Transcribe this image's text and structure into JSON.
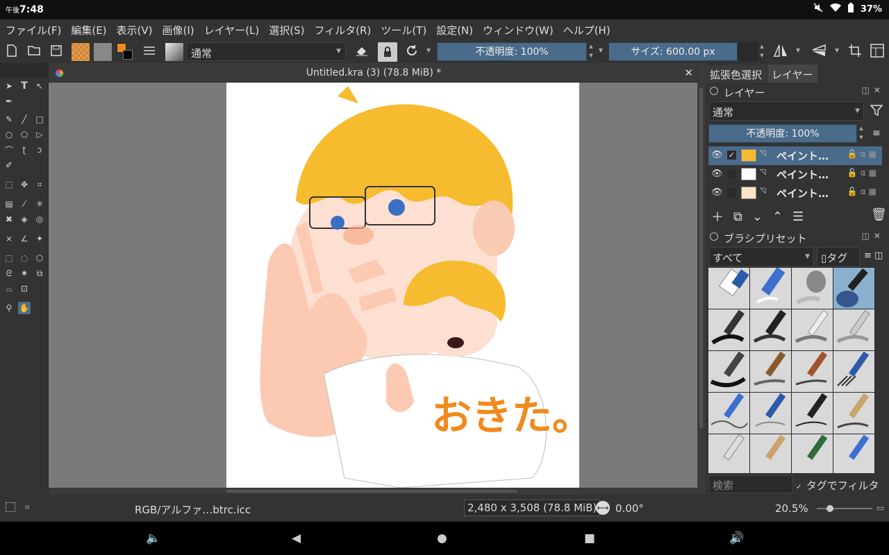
{
  "status_bar": {
    "time_prefix": "午後",
    "time": "7:48",
    "battery": "37%"
  },
  "menu": [
    "ファイル(F)",
    "編集(E)",
    "表示(V)",
    "画像(I)",
    "レイヤー(L)",
    "選択(S)",
    "フィルタ(R)",
    "ツール(T)",
    "設定(N)",
    "ウィンドウ(W)",
    "ヘルプ(H)"
  ],
  "toolbar": {
    "blend_mode": "通常",
    "opacity_label": "不透明度: 100%",
    "size_label": "サイズ: 600.00 px"
  },
  "document": {
    "title": "Untitled.kra (3) (78.8 MiB) *",
    "artwork_text": "おきた。"
  },
  "docker": {
    "tabs": [
      "拡張色選択",
      "レイヤー"
    ],
    "layers_panel": {
      "title": "レイヤー",
      "blend_mode": "通常",
      "opacity_label": "不透明度: 100%",
      "layers": [
        {
          "name": "ペイント…",
          "selected": true
        },
        {
          "name": "ペイント…",
          "selected": false
        },
        {
          "name": "ペイント…",
          "selected": false
        }
      ]
    },
    "brush_panel": {
      "title": "ブラシプリセット",
      "filter_all": "すべて",
      "tag_button": "タグ",
      "search_placeholder": "検索",
      "tag_filter_label": "タグでフィルタ"
    }
  },
  "statusline": {
    "color_profile": "RGB/アルファ…btrc.icc",
    "dimensions": "2,480 x 3,508 (78.8 MiB)",
    "rotation": "0.00°",
    "zoom": "20.5%"
  },
  "colors": {
    "foreground": "#f08a1c",
    "background": "#000000",
    "accent": "#4a6b8a"
  }
}
